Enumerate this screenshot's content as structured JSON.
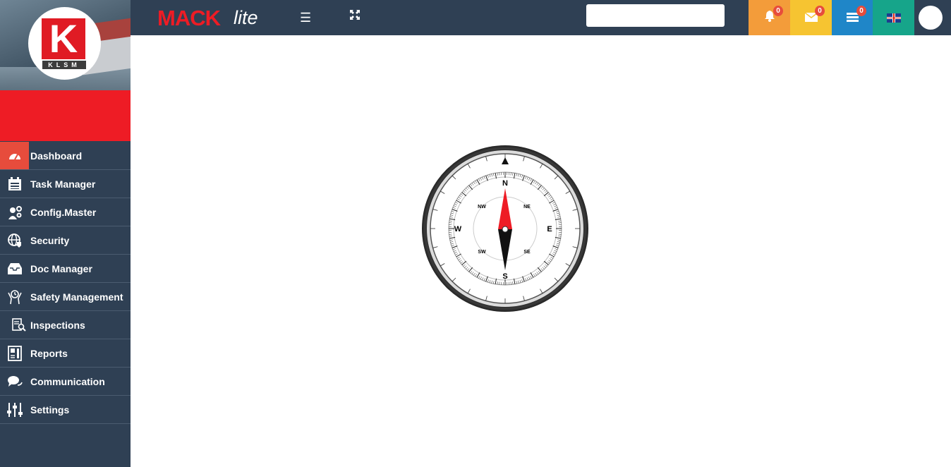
{
  "brand": {
    "name": "MACK",
    "suffix": "lite",
    "logo_text": "KLSM",
    "logo_letter": "K"
  },
  "topbar": {
    "search_placeholder": "",
    "notifications": {
      "icon": "bell-icon",
      "count": "0"
    },
    "messages": {
      "icon": "envelope-icon",
      "count": "0"
    },
    "tasks": {
      "icon": "tasks-icon",
      "count": "0"
    },
    "language": {
      "icon": "uk-flag-icon"
    },
    "colors": {
      "bell": "#f39c3a",
      "mail": "#f6c431",
      "tasks": "#1f86c8",
      "lang": "#16a58a"
    }
  },
  "sidebar": {
    "items": [
      {
        "label": "Dashboard",
        "icon": "dashboard-icon",
        "active": true
      },
      {
        "label": "Task Manager",
        "icon": "calendar-list-icon"
      },
      {
        "label": "Config.Master",
        "icon": "config-icon"
      },
      {
        "label": "Security",
        "icon": "globe-shield-icon"
      },
      {
        "label": "Doc Manager",
        "icon": "inbox-icon"
      },
      {
        "label": "Safety Management",
        "icon": "safety-icon"
      },
      {
        "label": "Inspections",
        "icon": "inspection-icon"
      },
      {
        "label": "Reports",
        "icon": "report-icon"
      },
      {
        "label": "Communication",
        "icon": "chat-icon"
      },
      {
        "label": "Settings",
        "icon": "sliders-icon"
      }
    ]
  },
  "compass": {
    "cardinals": [
      "N",
      "E",
      "S",
      "W"
    ],
    "intercardinals": [
      "NE",
      "SE",
      "SW",
      "NW"
    ]
  }
}
